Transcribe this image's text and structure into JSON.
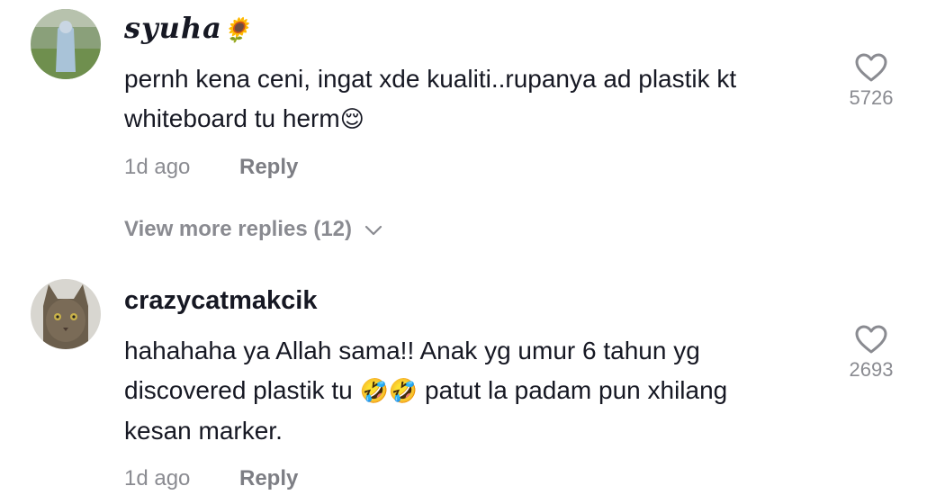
{
  "comments": [
    {
      "username": "syuha",
      "username_emoji": "🌻",
      "text_line1": "pernh kena ceni, ingat xde kualiti..rupanya ad plastik kt",
      "text_line2": "whiteboard tu herm",
      "text_emoji": "😌",
      "time": "1d ago",
      "reply_label": "Reply",
      "likes": "5726"
    },
    {
      "username": "crazycatmakcik",
      "text_line1": "hahahaha ya Allah sama!! Anak yg umur 6 tahun yg",
      "text_line2_a": "discovered plastik tu ",
      "text_emoji": "🤣🤣",
      "text_line2_b": " patut la padam pun xhilang",
      "text_line3": "kesan marker.",
      "time": "1d ago",
      "reply_label": "Reply",
      "likes": "2693"
    }
  ],
  "view_more": {
    "label": "View more replies (12)"
  },
  "colors": {
    "primary_text": "#161823",
    "secondary_text": "#8a8b91",
    "background": "#ffffff"
  }
}
